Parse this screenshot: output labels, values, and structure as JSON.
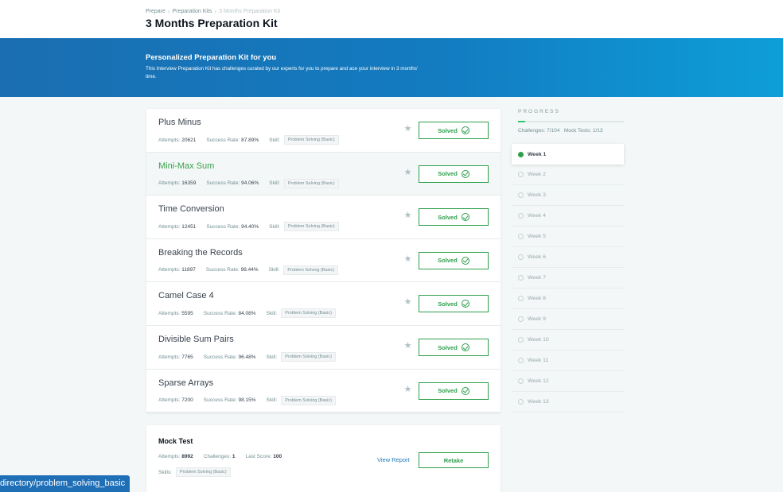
{
  "breadcrumb": [
    "Prepare",
    "Preparation Kits",
    "3 Months Preparation Kit"
  ],
  "title": "3 Months Preparation Kit",
  "banner": {
    "title": "Personalized Preparation Kit for you",
    "description": "This Interview Preparation Kit has challenges curated by our experts for you to prepare and ace your interview in 3 months' time."
  },
  "labels": {
    "attempts": "Attempts:",
    "success_rate": "Success Rate:",
    "skill": "Skill:",
    "solved": "Solved",
    "star_glyph": "★"
  },
  "challenges": [
    {
      "name": "Plus Minus",
      "attempts": "20621",
      "success_rate": "87.89%",
      "skill": "Problem Solving (Basic)",
      "status": "Solved"
    },
    {
      "name": "Mini-Max Sum",
      "attempts": "16359",
      "success_rate": "94.06%",
      "skill": "Problem Solving (Basic)",
      "status": "Solved"
    },
    {
      "name": "Time Conversion",
      "attempts": "12451",
      "success_rate": "94.40%",
      "skill": "Problem Solving (Basic)",
      "status": "Solved"
    },
    {
      "name": "Breaking the Records",
      "attempts": "11897",
      "success_rate": "98.44%",
      "skill": "Problem Solving (Basic)",
      "status": "Solved"
    },
    {
      "name": "Camel Case 4",
      "attempts": "5595",
      "success_rate": "84.08%",
      "skill": "Problem Solving (Basic)",
      "status": "Solved"
    },
    {
      "name": "Divisible Sum Pairs",
      "attempts": "7765",
      "success_rate": "96.48%",
      "skill": "Problem Solving (Basic)",
      "status": "Solved"
    },
    {
      "name": "Sparse Arrays",
      "attempts": "7200",
      "success_rate": "98.15%",
      "skill": "Problem Solving (Basic)",
      "status": "Solved"
    }
  ],
  "mock_test": {
    "title": "Mock Test",
    "attempts_label": "Attempts:",
    "attempts": "8992",
    "challenges_label": "Challenges:",
    "challenges": "1",
    "last_score_label": "Last Score:",
    "last_score": "100",
    "skills_label": "Skills:",
    "skill": "Problem Solving (Basic)",
    "view_report": "View Report",
    "retake": "Retake"
  },
  "progress": {
    "label": "PROGRESS",
    "challenges_text": "Challenges: 7/104",
    "mock_tests_text": "Mock Tests: 1/13",
    "fraction": 0.067,
    "weeks": [
      "Week 1",
      "Week 2",
      "Week 3",
      "Week 4",
      "Week 5",
      "Week 6",
      "Week 7",
      "Week 8",
      "Week 9",
      "Week 10",
      "Week 11",
      "Week 12",
      "Week 13"
    ],
    "active_week": "Week 1"
  },
  "status_url": "directory/problem_solving_basic",
  "colors": {
    "accent_green": "#2ea04c",
    "banner_blue": "#1b6eb1"
  }
}
